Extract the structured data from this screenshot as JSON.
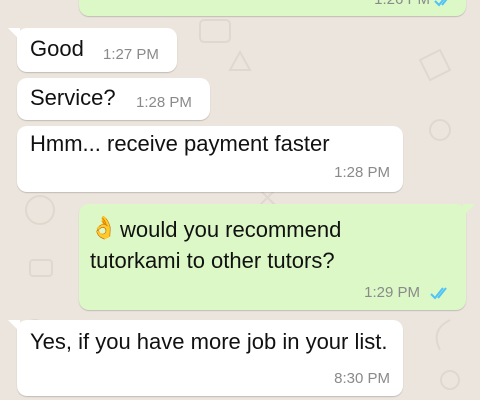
{
  "colors": {
    "chat_background": "#ECE5DD",
    "incoming_bubble": "#FFFFFF",
    "outgoing_bubble": "#DCF8C6",
    "read_ticks": "#4FC3F7",
    "timestamp": "#8A8A8A"
  },
  "messages": [
    {
      "direction": "outgoing",
      "text": "",
      "time": "1:26 PM",
      "status_icon": "double-check-read-icon"
    },
    {
      "direction": "incoming",
      "text": "Good",
      "time": "1:27 PM"
    },
    {
      "direction": "incoming",
      "text": "Service?",
      "time": "1:28 PM"
    },
    {
      "direction": "incoming",
      "text": "Hmm... receive payment faster",
      "time": "1:28 PM"
    },
    {
      "direction": "outgoing",
      "emoji": "👌",
      "emoji_name": "ok-hand-emoji",
      "text": "would you recommend tutorkami to other tutors?",
      "time": "1:29 PM",
      "status_icon": "double-check-read-icon"
    },
    {
      "direction": "incoming",
      "text": "Yes, if you have more job in your list.",
      "time": "8:30 PM"
    }
  ]
}
